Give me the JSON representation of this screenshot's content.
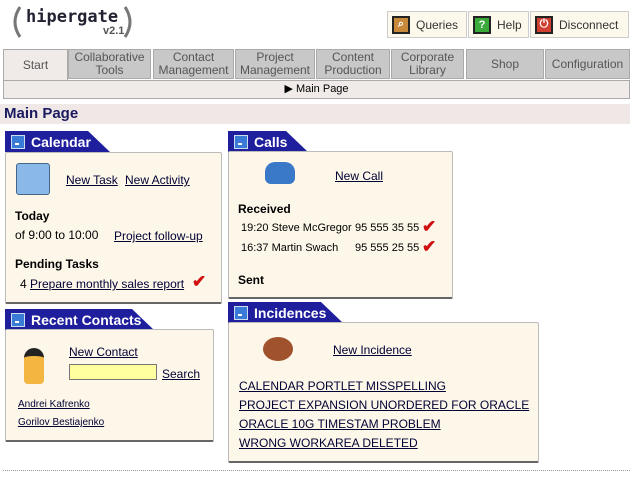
{
  "logo": {
    "name": "hipergate",
    "version": "v2.1"
  },
  "toolbar": {
    "queries": "Queries",
    "help": "Help",
    "disconnect": "Disconnect"
  },
  "tabs": [
    "Start",
    "Collaborative Tools",
    "Contact Management",
    "Project Management",
    "Content Production",
    "Corporate Library",
    "Shop",
    "Configuration"
  ],
  "breadcrumb": "Main Page",
  "page_title": "Main Page",
  "calendar": {
    "title": "Calendar",
    "new_task": "New Task",
    "new_activity": "New Activity",
    "today": "Today",
    "time": "of 9:00 to 10:00",
    "meeting": "Project follow-up",
    "pending": "Pending Tasks",
    "task_num": "4",
    "task": "Prepare monthly sales report"
  },
  "contacts": {
    "title": "Recent Contacts",
    "new_contact": "New Contact",
    "search_value": "",
    "search": "Search",
    "items": [
      "Andrei Kafrenko",
      "Gorilov Bestiajenko"
    ]
  },
  "calls": {
    "title": "Calls",
    "new_call": "New Call",
    "received": "Received",
    "rows": [
      {
        "time": "19:20",
        "name": "Steve McGregor",
        "phone": "95 555 35 55"
      },
      {
        "time": "16:37",
        "name": "Martin Swach",
        "phone": "95 555 25 55"
      }
    ],
    "sent": "Sent"
  },
  "incidences": {
    "title": "Incidences",
    "new": "New Incidence",
    "items": [
      "CALENDAR PORTLET MISSPELLING",
      "PROJECT EXPANSION UNORDERED FOR ORACLE",
      "ORACLE 10G TIMESTAM PROBLEM",
      "WRONG WORKAREA DELETED"
    ]
  }
}
